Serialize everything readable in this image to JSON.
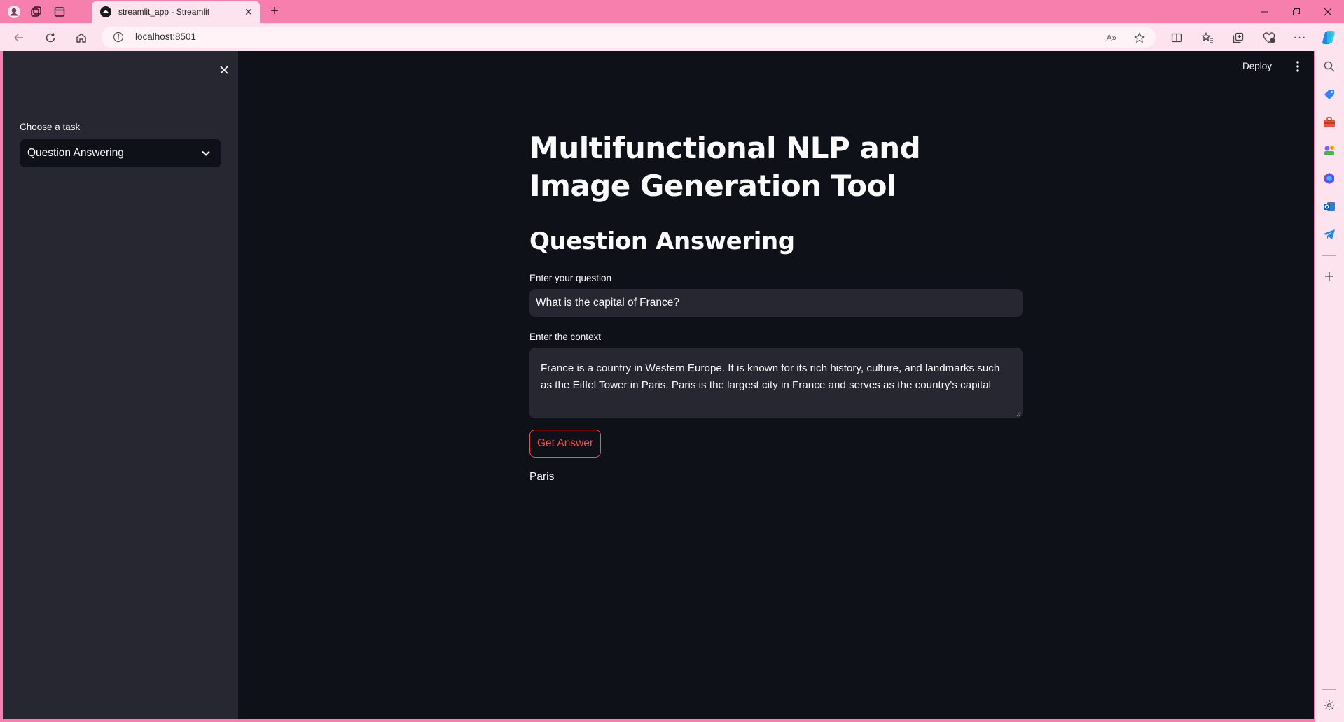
{
  "browser": {
    "tab_title": "streamlit_app - Streamlit",
    "url": "localhost:8501",
    "read_aloud_label": "A»"
  },
  "sidebar": {
    "select_label": "Choose a task",
    "selected_task": "Question Answering"
  },
  "header": {
    "deploy_label": "Deploy"
  },
  "main": {
    "title": "Multifunctional NLP and Image Generation Tool",
    "subtitle": "Question Answering",
    "question_label": "Enter your question",
    "question_value": "What is the capital of France?",
    "context_label": "Enter the context",
    "context_value": "France is a country in Western Europe. It is known for its rich history, culture, and landmarks such as the Eiffel Tower in Paris. Paris is the largest city in France and serves as the country's capital",
    "button_label": "Get Answer",
    "answer": "Paris"
  },
  "colors": {
    "browser_frame": "#f77fae",
    "browser_toolbar": "#fde3ee",
    "app_background": "#0e1117",
    "sidebar_background": "#262730",
    "primary_accent": "#ff4b4b",
    "text": "#fafafa"
  }
}
